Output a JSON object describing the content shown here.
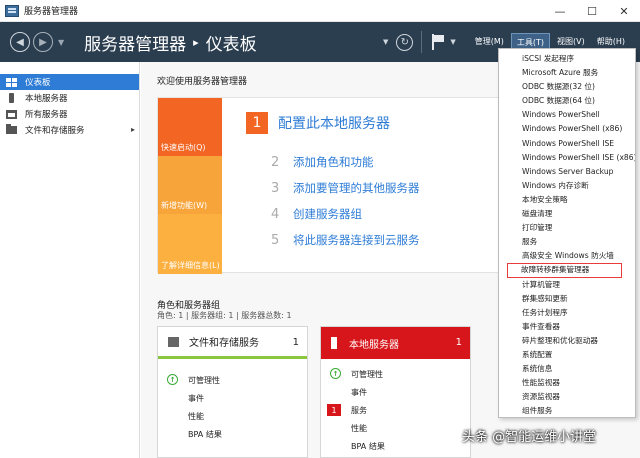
{
  "window": {
    "title": "服务器管理器",
    "icon": "server-manager-icon",
    "minimize": "—",
    "maximize": "☐",
    "close": "✕"
  },
  "header": {
    "breadcrumb_root": "服务器管理器",
    "breadcrumb_sep": "▸",
    "breadcrumb_current": "仪表板",
    "menu": [
      "管理(M)",
      "工具(T)",
      "视图(V)",
      "帮助(H)"
    ],
    "active_menu": "工具(T)"
  },
  "sidebar": {
    "items": [
      {
        "label": "仪表板",
        "icon": "dashboard-icon",
        "active": true
      },
      {
        "label": "本地服务器",
        "icon": "server-icon"
      },
      {
        "label": "所有服务器",
        "icon": "servers-icon"
      },
      {
        "label": "文件和存储服务",
        "icon": "folder-icon",
        "chevron": "▸"
      }
    ]
  },
  "main": {
    "welcome_title": "欢迎使用服务器管理器",
    "quick_start": {
      "tiles": [
        "快速启动(Q)",
        "新增功能(W)",
        "了解详细信息(L)"
      ],
      "steps": [
        {
          "num": "1",
          "label": "配置此本地服务器"
        },
        {
          "num": "2",
          "label": "添加角色和功能"
        },
        {
          "num": "3",
          "label": "添加要管理的其他服务器"
        },
        {
          "num": "4",
          "label": "创建服务器组"
        },
        {
          "num": "5",
          "label": "将此服务器连接到云服务"
        }
      ]
    },
    "roles": {
      "title": "角色和服务器组",
      "subtitle": "角色: 1 | 服务器组: 1 | 服务器总数: 1"
    },
    "cards": [
      {
        "title": "文件和存储服务",
        "count": "1",
        "rows": [
          {
            "label": "可管理性",
            "status": "ok"
          },
          {
            "label": "事件"
          },
          {
            "label": "性能"
          },
          {
            "label": "BPA 结果"
          }
        ]
      },
      {
        "title": "本地服务器",
        "count": "1",
        "rows": [
          {
            "label": "可管理性",
            "status": "ok"
          },
          {
            "label": "事件"
          },
          {
            "label": "服务",
            "badge": "1"
          },
          {
            "label": "性能"
          },
          {
            "label": "BPA 结果"
          }
        ]
      }
    ]
  },
  "tools_menu": {
    "items": [
      "iSCSI 发起程序",
      "Microsoft Azure 服务",
      "ODBC 数据源(32 位)",
      "ODBC 数据源(64 位)",
      "Windows PowerShell",
      "Windows PowerShell (x86)",
      "Windows PowerShell ISE",
      "Windows PowerShell ISE (x86)",
      "Windows Server Backup",
      "Windows 内存诊断",
      "本地安全策略",
      "磁盘清理",
      "打印管理",
      "服务",
      "高级安全 Windows 防火墙",
      "故障转移群集管理器",
      "计算机管理",
      "群集感知更新",
      "任务计划程序",
      "事件查看器",
      "碎片整理和优化驱动器",
      "系统配置",
      "系统信息",
      "性能监视器",
      "资源监视器",
      "组件服务"
    ],
    "highlighted": "故障转移群集管理器"
  },
  "watermark": "头条 @智能运维小讲堂"
}
